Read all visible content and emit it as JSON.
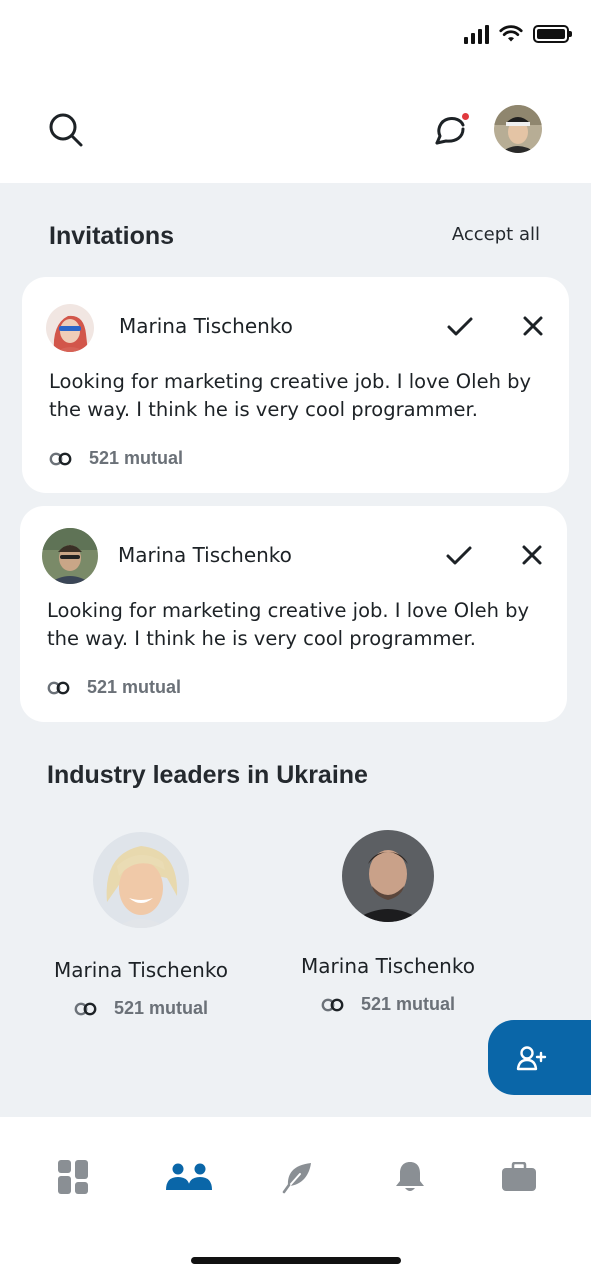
{
  "invitations": {
    "title": "Invitations",
    "accept_all_label": "Accept all",
    "items": [
      {
        "name": "Marina Tischenko",
        "message": "Looking for marketing creative job. I love Oleh by the way. I think he is very cool programmer.",
        "mutual": "521 mutual"
      },
      {
        "name": "Marina Tischenko",
        "message": "Looking for marketing creative job. I love Oleh by the way. I think he is very cool programmer.",
        "mutual": "521 mutual"
      }
    ]
  },
  "leaders": {
    "title": "Industry leaders in Ukraine",
    "items": [
      {
        "name": "Marina Tischenko",
        "mutual": "521 mutual"
      },
      {
        "name": "Marina Tischenko",
        "mutual": "521 mutual"
      }
    ]
  },
  "header": {
    "icons": [
      "search-icon",
      "chat-icon",
      "avatar"
    ]
  },
  "bottom_nav": {
    "items": [
      "dashboard-icon",
      "network-icon",
      "feather-icon",
      "bell-icon",
      "briefcase-icon"
    ],
    "active": "network-icon"
  },
  "colors": {
    "accent": "#0a66a8",
    "notification_dot": "#e0393e",
    "background": "#eef1f4",
    "card": "#ffffff",
    "muted_text": "#6b7178",
    "nav_icon": "#8a8f94"
  }
}
